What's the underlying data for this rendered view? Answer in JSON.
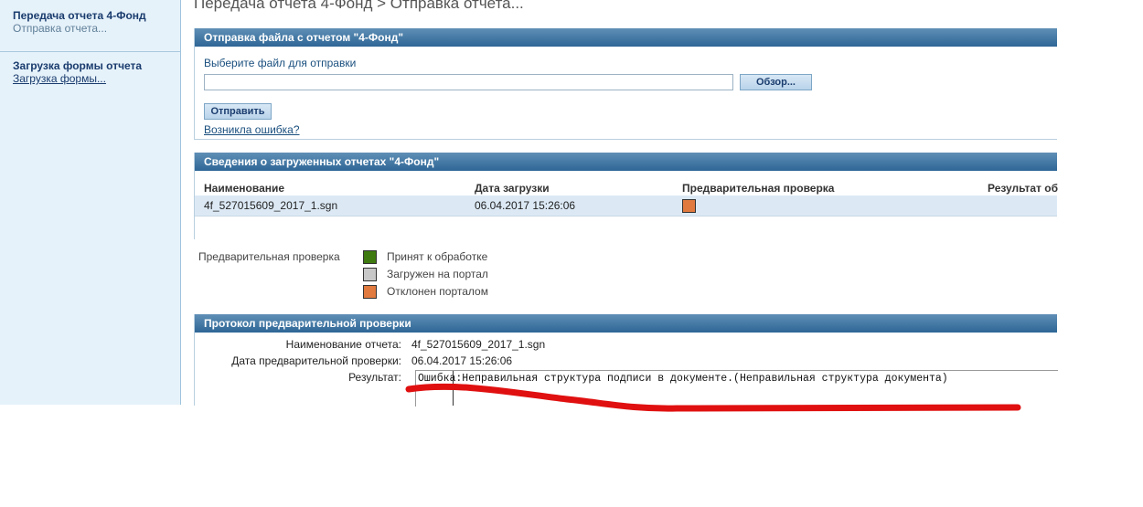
{
  "sidebar": {
    "item1": {
      "title": "Передача отчета 4-Фонд",
      "sub": "Отправка отчета..."
    },
    "item2": {
      "title": "Загрузка формы отчета",
      "link": "Загрузка формы..."
    }
  },
  "page_title": "Передача отчета 4-Фонд > Отправка отчета...",
  "upload": {
    "header": "Отправка файла с отчетом \"4-Фонд\"",
    "choose_label": "Выберите файл для отправки",
    "file_value": "",
    "browse_label": "Обзор...",
    "send_label": "Отправить",
    "error_link": "Возникла ошибка?"
  },
  "reports": {
    "header": "Сведения о загруженных отчетах \"4-Фонд\"",
    "columns": [
      "Наименование",
      "Дата загрузки",
      "Предварительная проверка",
      "Результат об"
    ],
    "rows": [
      {
        "name": "4f_527015609_2017_1.sgn",
        "date": "06.04.2017 15:26:06",
        "status_color": "#e07a3f"
      }
    ]
  },
  "legend": {
    "title": "Предварительная проверка",
    "items": [
      {
        "label": "Принят к обработке",
        "color": "#3f7a10"
      },
      {
        "label": "Загружен на портал",
        "color": "#c8c8c8"
      },
      {
        "label": "Отклонен порталом",
        "color": "#e07a3f"
      }
    ]
  },
  "protocol": {
    "header": "Протокол предварительной проверки",
    "name_label": "Наименование отчета:",
    "name_value": "4f_527015609_2017_1.sgn",
    "date_label": "Дата предварительной проверки:",
    "date_value": "06.04.2017 15:26:06",
    "result_label": "Результат:",
    "result_value": "Ошибка:Неправильная структура подписи в документе.(Неправильная структура документа)"
  },
  "colors": {
    "header_gradient_top": "#5f8fb6",
    "header_gradient_bottom": "#2e6696",
    "sidebar_bg": "#e6f2fa",
    "annotation_red": "#e01010"
  }
}
